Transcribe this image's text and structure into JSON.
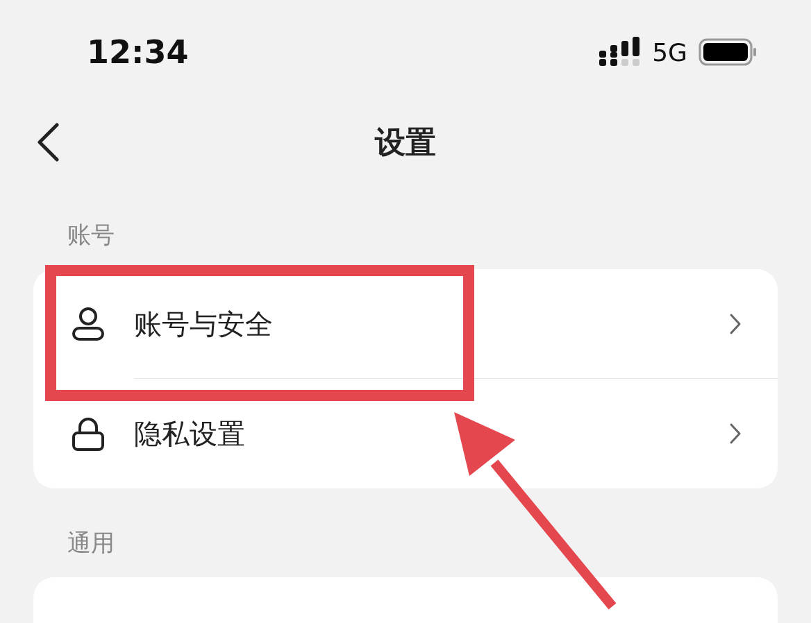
{
  "status_bar": {
    "time": "12:34",
    "network": "5G"
  },
  "nav": {
    "title": "设置"
  },
  "sections": [
    {
      "label": "账号",
      "items": [
        {
          "label": "账号与安全",
          "kind": "person"
        },
        {
          "label": "隐私设置",
          "kind": "lock"
        }
      ]
    },
    {
      "label": "通用"
    }
  ]
}
